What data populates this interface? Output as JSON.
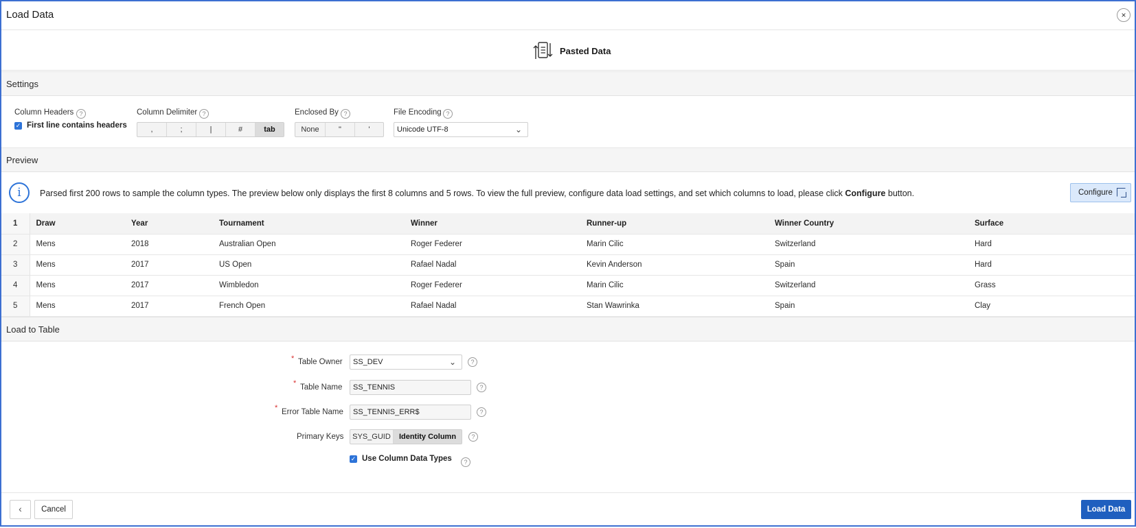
{
  "dialog": {
    "title": "Load Data",
    "close_glyph": "×"
  },
  "source": {
    "icon": "pasted-data-icon",
    "label": "Pasted Data"
  },
  "settings": {
    "section_title": "Settings",
    "column_headers": {
      "label": "Column Headers",
      "checkbox_label": "First line contains headers",
      "checked": true
    },
    "column_delimiter": {
      "label": "Column Delimiter",
      "options": [
        ",",
        ";",
        "|",
        "#",
        "tab"
      ],
      "selected": "tab"
    },
    "enclosed_by": {
      "label": "Enclosed By",
      "options": [
        "None",
        "\"",
        "'"
      ],
      "selected": "None"
    },
    "file_encoding": {
      "label": "File Encoding",
      "value": "Unicode UTF-8"
    }
  },
  "preview": {
    "section_title": "Preview",
    "info_text_prefix": "Parsed first 200 rows to sample the column types. The preview below only displays the first 8 columns and 5 rows. To view the full preview, configure data load settings, and set which columns to load, please click ",
    "info_text_bold": "Configure",
    "info_text_suffix": " button.",
    "configure_label": "Configure",
    "header_row_number": "1",
    "columns": [
      "Draw",
      "Year",
      "Tournament",
      "Winner",
      "Runner-up",
      "Winner Country",
      "Surface"
    ],
    "rows": [
      {
        "n": "2",
        "cells": [
          "Mens",
          "2018",
          "Australian Open",
          "Roger Federer",
          "Marin Cilic",
          "Switzerland",
          "Hard"
        ]
      },
      {
        "n": "3",
        "cells": [
          "Mens",
          "2017",
          "US Open",
          "Rafael Nadal",
          "Kevin Anderson",
          "Spain",
          "Hard"
        ]
      },
      {
        "n": "4",
        "cells": [
          "Mens",
          "2017",
          "Wimbledon",
          "Roger Federer",
          "Marin Cilic",
          "Switzerland",
          "Grass"
        ]
      },
      {
        "n": "5",
        "cells": [
          "Mens",
          "2017",
          "French Open",
          "Rafael Nadal",
          "Stan Wawrinka",
          "Spain",
          "Clay"
        ]
      }
    ]
  },
  "load_to_table": {
    "section_title": "Load to Table",
    "table_owner": {
      "label": "Table Owner",
      "value": "SS_DEV"
    },
    "table_name": {
      "label": "Table Name",
      "value": "SS_TENNIS"
    },
    "error_table_name": {
      "label": "Error Table Name",
      "value": "SS_TENNIS_ERR$"
    },
    "primary_keys": {
      "label": "Primary Keys",
      "options": [
        "SYS_GUID",
        "Identity Column"
      ],
      "selected": "Identity Column"
    },
    "use_column_data_types": {
      "label": "Use Column Data Types",
      "checked": true
    },
    "required_marker": "*"
  },
  "footer": {
    "back_glyph": "‹",
    "cancel_label": "Cancel",
    "load_label": "Load Data"
  },
  "colors": {
    "accent": "#2d73d8",
    "primary_button": "#1f5fbf",
    "required": "#d93030",
    "dialog_border": "#3c6fd1"
  }
}
